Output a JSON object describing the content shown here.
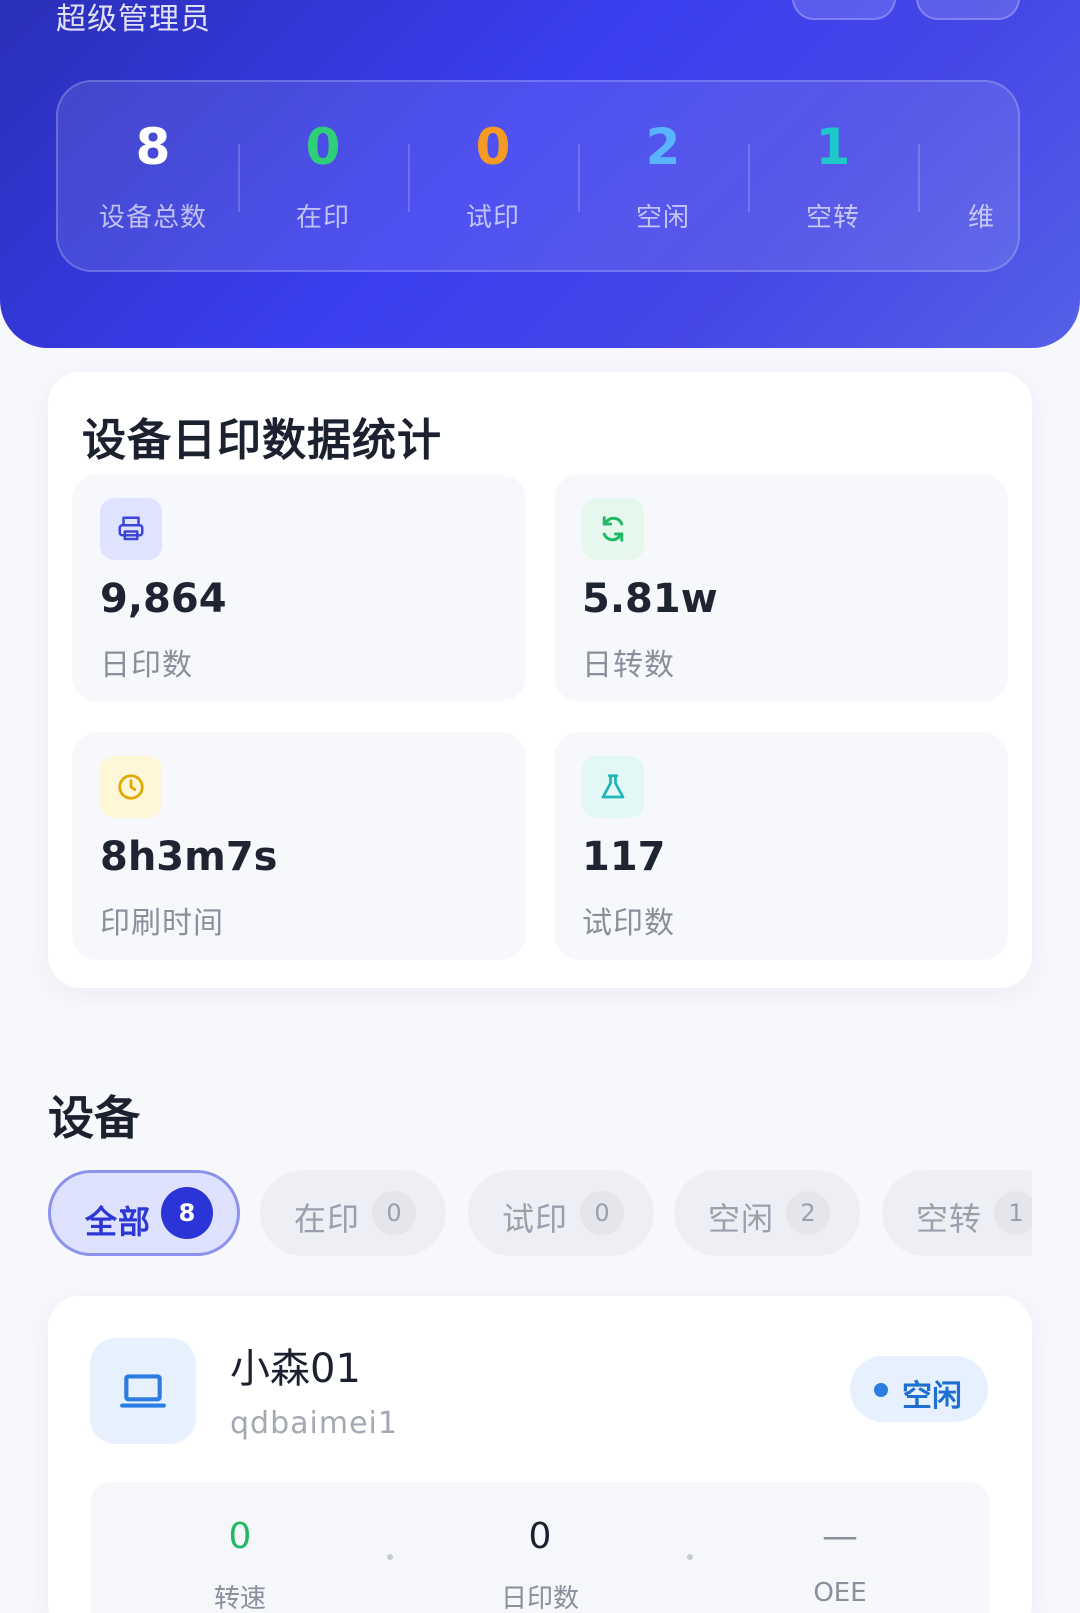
{
  "header": {
    "role": "超级管理员",
    "stats": [
      {
        "value": "8",
        "label": "设备总数",
        "color": "#ffffff"
      },
      {
        "value": "0",
        "label": "在印",
        "color": "#2fcf7a"
      },
      {
        "value": "0",
        "label": "试印",
        "color": "#f59a23"
      },
      {
        "value": "2",
        "label": "空闲",
        "color": "#5ab3ff"
      },
      {
        "value": "1",
        "label": "空转",
        "color": "#1fc9c9"
      },
      {
        "value": "",
        "label": "维",
        "color": "#ffffff"
      }
    ]
  },
  "daily": {
    "title": "设备日印数据统计",
    "metrics": [
      {
        "icon": "printer-icon",
        "value": "9,864",
        "label": "日印数",
        "icon_bg": "#dfe3ff",
        "icon_color": "#3b46d9"
      },
      {
        "icon": "sync-icon",
        "value": "5.81w",
        "label": "日转数",
        "icon_bg": "#e6f8ee",
        "icon_color": "#22b865"
      },
      {
        "icon": "clock-icon",
        "value": "8h3m7s",
        "label": "印刷时间",
        "icon_bg": "#fdf6d7",
        "icon_color": "#e0a800"
      },
      {
        "icon": "flask-icon",
        "value": "117",
        "label": "试印数",
        "icon_bg": "#e3f7f7",
        "icon_color": "#1fb6b6"
      }
    ]
  },
  "devices": {
    "title": "设备",
    "filters": [
      {
        "label": "全部",
        "count": "8",
        "active": true
      },
      {
        "label": "在印",
        "count": "0",
        "active": false
      },
      {
        "label": "试印",
        "count": "0",
        "active": false
      },
      {
        "label": "空闲",
        "count": "2",
        "active": false
      },
      {
        "label": "空转",
        "count": "1",
        "active": false
      }
    ],
    "card": {
      "name": "小森01",
      "id": "qdbaimei1",
      "status": "空闲",
      "metrics": [
        {
          "value": "0",
          "label": "转速",
          "color": "#22b865"
        },
        {
          "value": "0",
          "label": "日印数",
          "color": "#1c2130"
        },
        {
          "value": "—",
          "label": "OEE",
          "color": "#8a8f9c"
        }
      ]
    }
  }
}
